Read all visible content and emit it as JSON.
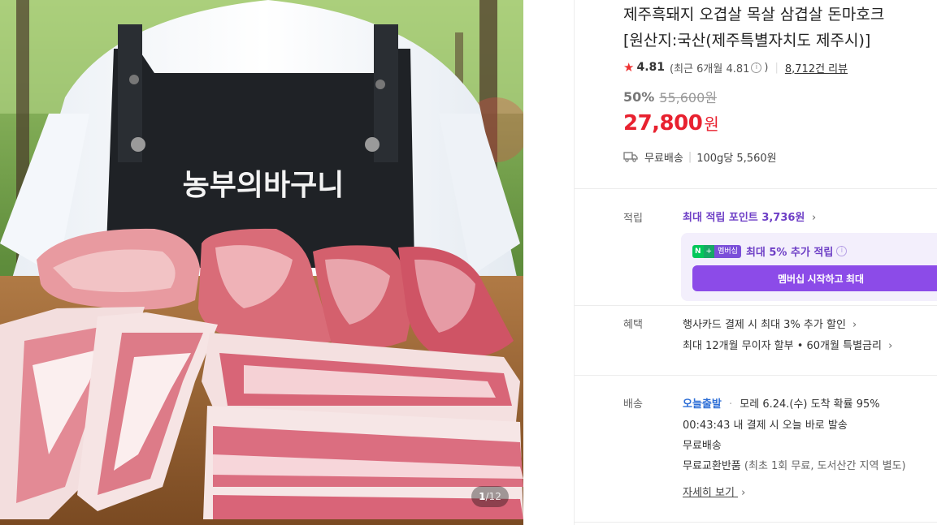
{
  "image": {
    "apron_text": "농부의바구니",
    "pager_current": "1",
    "pager_total": "/12"
  },
  "product": {
    "title_line1": "제주흑돼지 오겹살 목살 삼겹살 돈마호크",
    "title_line2": "[원산지:국산(제주특별자치도 제주시)]"
  },
  "rating": {
    "score": "4.81",
    "recent": "(최근 6개월 4.81",
    "recent_close": ")",
    "reviews": "8,712건 리뷰"
  },
  "price": {
    "discount_rate": "50%",
    "original": "55,600원",
    "sale": "27,800",
    "unit": "원"
  },
  "shipping_summary": {
    "free": "무료배송",
    "unit_price": "100g당 5,560원"
  },
  "points": {
    "label": "적립",
    "max_point_text": "최대 적립 포인트",
    "max_point_value": "3,736원",
    "membership_badge_n": "N",
    "membership_badge_plus": "+",
    "membership_badge_text": "멤버십",
    "membership_text": "최대 5% 추가 적립",
    "membership_button": "멤버십 시작하고 최대"
  },
  "benefits": {
    "label": "혜택",
    "line1": "행사카드 결제 시 최대 3% 추가 할인",
    "line2": "최대 12개월 무이자 할부 • 60개월 특별금리"
  },
  "delivery": {
    "label": "배송",
    "today": "오늘출발",
    "separator": "·",
    "eta": "모레 6.24.(수) 도착 확률 95%",
    "countdown": "00:43:43",
    "countdown_text": "내 결제 시 오늘 바로 발송",
    "free": "무료배송",
    "exchange": "무료교환반품",
    "exchange_note": "(최초 1회 무료, 도서산간 지역 별도)",
    "more": "자세히 보기"
  },
  "colors": {
    "price_red": "#e8212f",
    "star_red": "#ee3131",
    "membership_purple": "#8c4be8",
    "point_purple": "#6e3fc6",
    "today_blue": "#2e6fd6"
  },
  "icons": [
    "star-icon",
    "info-icon",
    "truck-icon",
    "chevron-right-icon",
    "naver-membership-badge"
  ]
}
